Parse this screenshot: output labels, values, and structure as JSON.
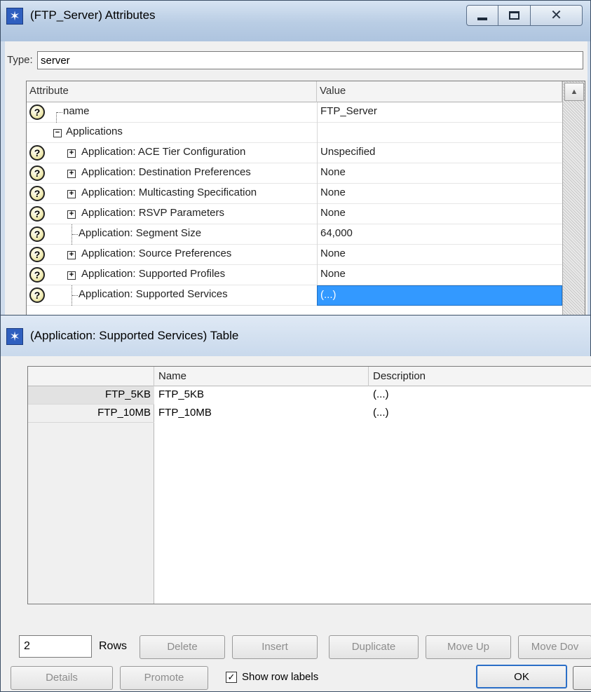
{
  "attr_window": {
    "title": "(FTP_Server) Attributes",
    "type_label": "Type:",
    "type_value": "server",
    "columns": [
      "Attribute",
      "Value"
    ],
    "rows": [
      {
        "name": "name",
        "value": "FTP_Server"
      },
      {
        "name": "Applications",
        "value": ""
      },
      {
        "name": "Application: ACE Tier Configuration",
        "value": "Unspecified"
      },
      {
        "name": "Application: Destination Preferences",
        "value": "None"
      },
      {
        "name": "Application: Multicasting Specification",
        "value": "None"
      },
      {
        "name": "Application: RSVP Parameters",
        "value": "None"
      },
      {
        "name": "Application: Segment Size",
        "value": "64,000"
      },
      {
        "name": "Application: Source Preferences",
        "value": "None"
      },
      {
        "name": "Application: Supported Profiles",
        "value": "None"
      },
      {
        "name": "Application: Supported Services",
        "value": "(...)"
      }
    ],
    "selected_row": 9
  },
  "table_window": {
    "title": "(Application: Supported Services) Table",
    "columns": [
      "Name",
      "Description"
    ],
    "rows": [
      {
        "label": "FTP_5KB",
        "name": "FTP_5KB",
        "description": "(...)"
      },
      {
        "label": "FTP_10MB",
        "name": "FTP_10MB",
        "description": "(...)"
      }
    ],
    "rows_count": "2",
    "rows_label": "Rows",
    "buttons": {
      "delete": "Delete",
      "insert": "Insert",
      "duplicate": "Duplicate",
      "move_up": "Move Up",
      "move_down": "Move Dov",
      "details": "Details",
      "promote": "Promote",
      "ok": "OK"
    },
    "show_row_labels": "Show row labels",
    "show_row_labels_checked": true
  },
  "icons": {
    "app": "opnet-star-icon",
    "help": "question-mark-icon",
    "minimize": "minimize-icon",
    "maximize": "maximize-icon",
    "close": "close-icon"
  },
  "colors": {
    "selection": "#3399ff",
    "titlebar": "#b9cde4"
  }
}
